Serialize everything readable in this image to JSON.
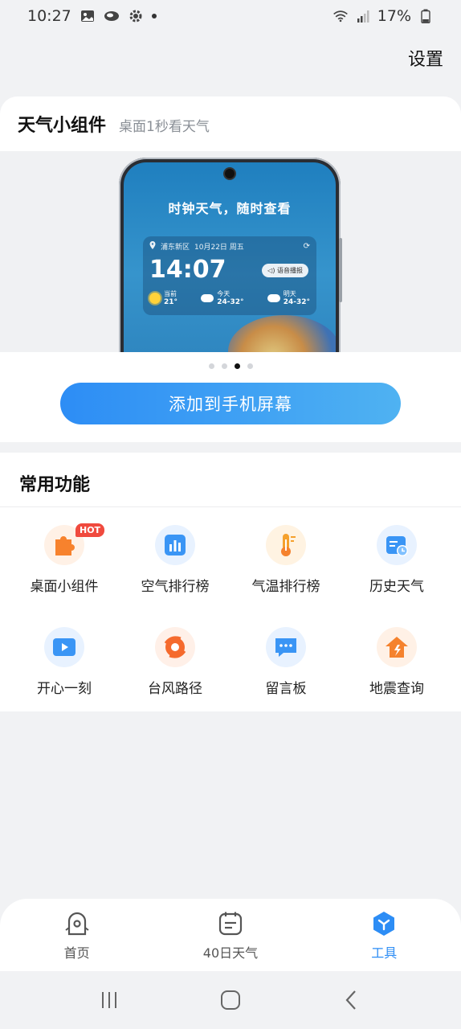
{
  "status_bar": {
    "time": "10:27",
    "battery": "17%",
    "icons": [
      "image-icon",
      "cloud-icon",
      "gear-icon",
      "dot-icon",
      "wifi-icon",
      "signal-icon",
      "battery-icon"
    ]
  },
  "header": {
    "settings_label": "设置"
  },
  "widget_section": {
    "title": "天气小组件",
    "subtitle": "桌面1秒看天气",
    "preview": {
      "slogan": "时钟天气，随时查看",
      "location": "浦东新区",
      "date": "10月22日 周五",
      "time": "14:07",
      "voice_label": "语音播报",
      "cells": [
        {
          "label": "当前",
          "value": "21°"
        },
        {
          "label": "今天",
          "value": "24-32°"
        },
        {
          "label": "明天",
          "value": "24-32°"
        }
      ]
    },
    "pager": {
      "total": 4,
      "active_index": 2
    },
    "add_button": "添加到手机屏幕"
  },
  "functions": {
    "title": "常用功能",
    "hot_badge": "HOT",
    "items": [
      {
        "label": "桌面小组件",
        "icon": "puzzle-icon",
        "color": "#f7822d"
      },
      {
        "label": "空气排行榜",
        "icon": "bar-chart-icon",
        "color": "#3a95f5"
      },
      {
        "label": "气温排行榜",
        "icon": "thermometer-icon",
        "color": "#f5a12d"
      },
      {
        "label": "历史天气",
        "icon": "calendar-clock-icon",
        "color": "#3a95f5"
      },
      {
        "label": "开心一刻",
        "icon": "play-icon",
        "color": "#3a95f5"
      },
      {
        "label": "台风路径",
        "icon": "typhoon-icon",
        "color": "#f56a2d"
      },
      {
        "label": "留言板",
        "icon": "message-icon",
        "color": "#3a95f5"
      },
      {
        "label": "地震查询",
        "icon": "earthquake-icon",
        "color": "#f5822d"
      }
    ]
  },
  "bottom_nav": {
    "items": [
      {
        "label": "首页",
        "icon": "home-icon"
      },
      {
        "label": "40日天气",
        "icon": "calendar-icon"
      },
      {
        "label": "工具",
        "icon": "tools-icon"
      }
    ],
    "active_index": 2,
    "accent": "#2d8df5"
  }
}
